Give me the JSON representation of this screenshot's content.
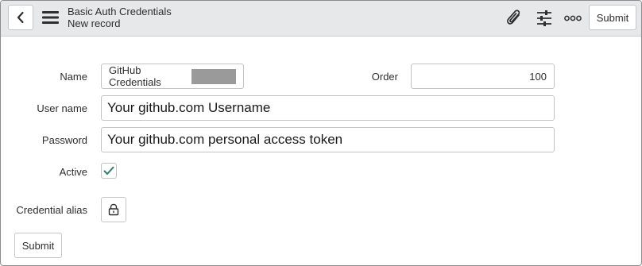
{
  "header": {
    "title": "Basic Auth Credentials",
    "subtitle": "New record",
    "back_icon": "chevron-left-icon",
    "menu_icon": "hamburger-menu-icon",
    "attachment_icon": "paperclip-icon",
    "personalize_icon": "sliders-icon",
    "more_icon": "more-options-icon",
    "submit_label": "Submit"
  },
  "form": {
    "name": {
      "label": "Name",
      "value": "GitHub Credentials"
    },
    "order": {
      "label": "Order",
      "value": "100"
    },
    "user_name": {
      "label": "User name",
      "value": "Your github.com Username"
    },
    "password": {
      "label": "Password",
      "value": "Your github.com personal access token"
    },
    "active": {
      "label": "Active",
      "checked": true
    },
    "credential_alias": {
      "label": "Credential alias",
      "icon": "lock-icon"
    },
    "submit_label": "Submit"
  },
  "colors": {
    "header_bg": "#e6e8ea",
    "check_color": "#2f7d6d",
    "border": "#bfc4c9"
  }
}
